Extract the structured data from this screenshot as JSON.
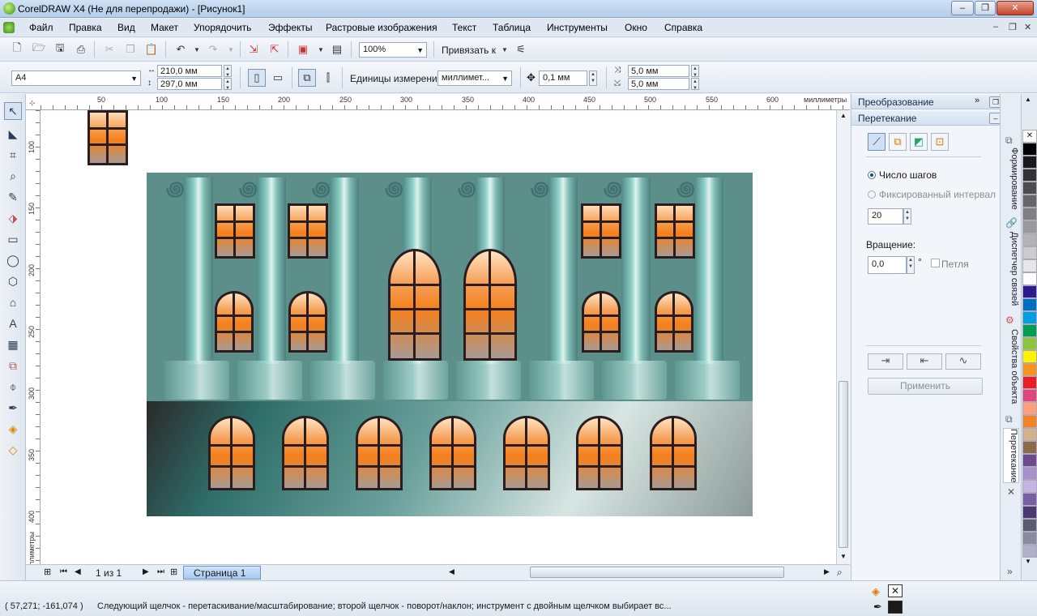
{
  "window": {
    "title": "CorelDRAW X4 (Не для перепродажи) - [Рисунок1]",
    "min": "–",
    "max": "❐",
    "close": "✕"
  },
  "menu": [
    "Файл",
    "Правка",
    "Вид",
    "Макет",
    "Упорядочить",
    "Эффекты",
    "Растровые изображения",
    "Текст",
    "Таблица",
    "Инструменты",
    "Окно",
    "Справка"
  ],
  "toolbar": {
    "zoom": "100%",
    "snap": "Привязать к"
  },
  "propbar": {
    "page_size": "A4",
    "width": "210,0 мм",
    "height": "297,0 мм",
    "units_label": "Единицы измерения:",
    "units_value": "миллимет...",
    "nudge": "0,1 мм",
    "dup_x": "5,0 мм",
    "dup_y": "5,0 мм"
  },
  "ruler": {
    "h_ticks": [
      "50",
      "100",
      "150",
      "200",
      "250",
      "300",
      "350",
      "400",
      "450",
      "500",
      "550",
      "600"
    ],
    "h_unit": "миллиметры",
    "v_ticks": [
      "100",
      "150",
      "200",
      "250",
      "300",
      "350",
      "400"
    ],
    "v_unit": "миллиметры"
  },
  "nav": {
    "page_counter": "1 из 1",
    "page_tab": "Страница 1"
  },
  "docker": {
    "transform_title": "Преобразование",
    "blend_title": "Перетекание",
    "steps_label": "Число шагов",
    "fixed_label": "Фиксированный интервал",
    "steps_value": "20",
    "rotation_label": "Вращение:",
    "rotation_value": "0,0",
    "degree": "°",
    "loop_label": "Петля",
    "apply_label": "Применить"
  },
  "vtabs": [
    "Формирование",
    "Диспетчер связей",
    "Свойства объекта",
    "Перетекание"
  ],
  "palette": [
    "#ffffff",
    "#000000",
    "#1a1a1a",
    "#333333",
    "#4d4d4d",
    "#666666",
    "#808080",
    "#999999",
    "#b3b3b3",
    "#cccccc",
    "#e6e6e6",
    "#ffffff",
    "#2e1a8c",
    "#0070c0",
    "#00a0e0",
    "#00a050",
    "#8cc63f",
    "#fff200",
    "#f7941d",
    "#ed1c24",
    "#e0457b",
    "#ffa07a",
    "#f58220",
    "#d2b48c",
    "#8b6b4a",
    "#6c4a8e",
    "#a890c8",
    "#c8b4e0",
    "#7a5fa0",
    "#4a3a70",
    "#5c5c70",
    "#8a8aa0",
    "#b0b0c8"
  ],
  "status": {
    "coords": "( 57,271; -161,074 )",
    "message": "Следующий щелчок - перетаскивание/масштабирование; второй щелчок - поворот/наклон; инструмент с двойным щелчком выбирает вс..."
  }
}
